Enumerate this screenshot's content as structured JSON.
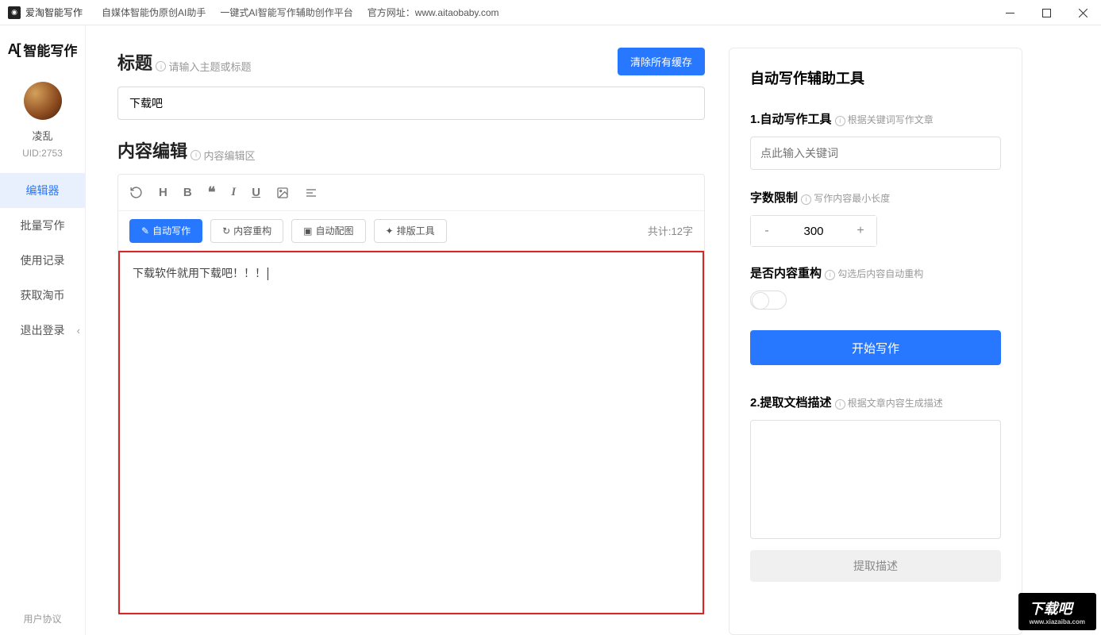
{
  "titlebar": {
    "app_name": "爱淘智能写作",
    "slogan1": "自媒体智能伪原创AI助手",
    "slogan2": "一键式AI智能写作辅助创作平台",
    "site_label": "官方网址：",
    "site_url": "www.aitaobaby.com"
  },
  "sidebar": {
    "logo": "智能写作",
    "username": "凌乱",
    "uid": "UID:2753",
    "nav": [
      "编辑器",
      "批量写作",
      "使用记录",
      "获取淘币",
      "退出登录"
    ],
    "footer": "用户协议"
  },
  "editor": {
    "title_label": "标题",
    "title_hint": "请输入主题或标题",
    "clear_cache": "清除所有缓存",
    "title_value": "下载吧",
    "content_label": "内容编辑",
    "content_hint": "内容编辑区",
    "actions": {
      "auto_write": "自动写作",
      "restructure": "内容重构",
      "auto_image": "自动配图",
      "layout_tool": "排版工具"
    },
    "word_count": "共计:12字",
    "body_text": "下载软件就用下载吧！！！"
  },
  "tools": {
    "panel_title": "自动写作辅助工具",
    "sec1_title": "1.自动写作工具",
    "sec1_hint": "根据关键词写作文章",
    "keyword_placeholder": "点此输入关键词",
    "word_limit_label": "字数限制",
    "word_limit_hint": "写作内容最小长度",
    "word_limit_value": "300",
    "restructure_label": "是否内容重构",
    "restructure_hint": "勾选后内容自动重构",
    "start_btn": "开始写作",
    "sec2_title": "2.提取文档描述",
    "sec2_hint": "根据文章内容生成描述",
    "extract_btn": "提取描述"
  },
  "watermark": {
    "main": "下载吧",
    "sub": "www.xiazaiba.com"
  }
}
